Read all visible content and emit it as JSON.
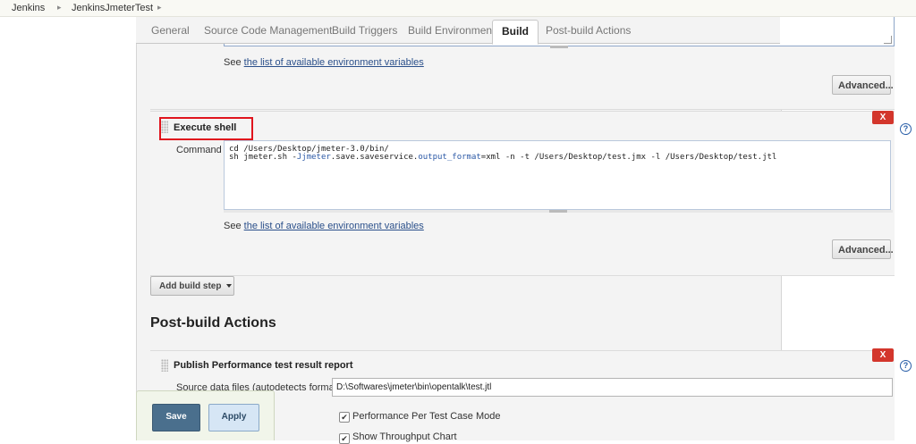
{
  "breadcrumb": {
    "items": [
      "Jenkins",
      "JenkinsJmeterTest"
    ]
  },
  "tabs": [
    {
      "label": "General"
    },
    {
      "label": "Source Code Management"
    },
    {
      "label": "Build Triggers"
    },
    {
      "label": "Build Environment"
    },
    {
      "label": "Build"
    },
    {
      "label": "Post-build Actions"
    }
  ],
  "active_tab": "Build",
  "prev_step": {
    "see_prefix": "See ",
    "see_link": "the list of available environment variables",
    "advanced_label": "Advanced..."
  },
  "execute_shell": {
    "title": "Execute shell",
    "delete_label": "X",
    "help_label": "?",
    "command_label": "Command",
    "command_line1": "cd /Users/Desktop/jmeter-3.0/bin/",
    "command_line2_a": "sh jmeter.sh -",
    "command_line2_b": "Jjmeter",
    "command_line2_c": ".save.saveservice.",
    "command_line2_d": "output_format",
    "command_line2_e": "=xml -n -t /Users/Desktop/test.jmx -l /Users/Desktop/test.jtl",
    "see_prefix": "See ",
    "see_link": "the list of available environment variables",
    "advanced_label": "Advanced..."
  },
  "add_build_step": {
    "label": "Add build step"
  },
  "post_build": {
    "heading": "Post-build Actions",
    "publish": {
      "title": "Publish Performance test result report",
      "delete_label": "X",
      "help_label": "?",
      "source_label": "Source data files (autodetects format):",
      "source_value": "D:\\Softwares\\jmeter\\bin\\opentalk\\test.jtl",
      "checkbox1_label": "Performance Per Test Case Mode",
      "checkbox2_label": "Show Throughput Chart"
    }
  },
  "footer": {
    "save_label": "Save",
    "apply_label": "Apply"
  },
  "colors": {
    "highlight": "#e0141d",
    "delete": "#d3362c",
    "save": "#4a6f8d",
    "link": "#2a4f8a"
  }
}
